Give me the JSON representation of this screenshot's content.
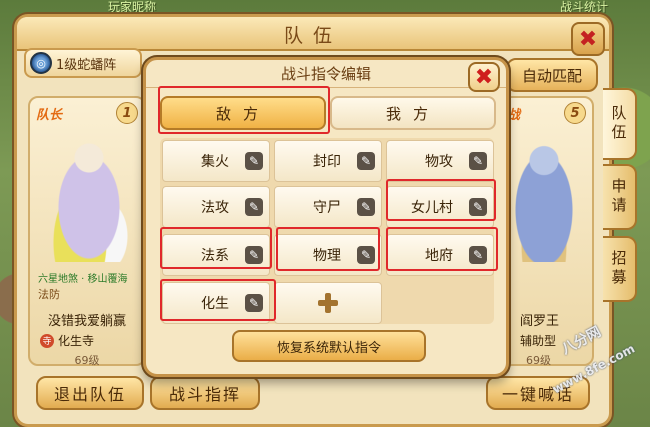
{
  "world": {
    "top_left_text": "玩家昵称",
    "top_right_text": "战斗统计"
  },
  "team_panel": {
    "title": "队伍",
    "close_symbol": "✖",
    "formation_label": "1级蛇蟠阵",
    "auto_match_label": "自动匹配",
    "side_tabs": [
      "队伍",
      "申请",
      "招募"
    ],
    "leader_slot": {
      "role": "队长",
      "index": "1",
      "sect_line": "六星地煞 · 移山覆海",
      "school_text": "法防",
      "name": "没错我爱躺赢",
      "sect": "化生寺",
      "level": "69级"
    },
    "right_slot": {
      "role": "助战",
      "index": "5",
      "school_text": "",
      "name": "阎罗王",
      "type": "辅助型",
      "level": "69级"
    },
    "bottom_buttons": {
      "leave": "退出队伍",
      "command": "战斗指挥",
      "onekey": "一键喊话"
    }
  },
  "modal": {
    "title": "战斗指令编辑",
    "close_symbol": "✖",
    "tabs": {
      "enemy": "敌方",
      "self": "我方"
    },
    "commands": [
      "集火",
      "封印",
      "物攻",
      "法攻",
      "守尸",
      "女儿村",
      "法系",
      "物理",
      "地府",
      "化生"
    ],
    "reset_label": "恢复系统默认指令"
  },
  "watermark": {
    "text": "八分网",
    "url": "www.8fe.com"
  }
}
